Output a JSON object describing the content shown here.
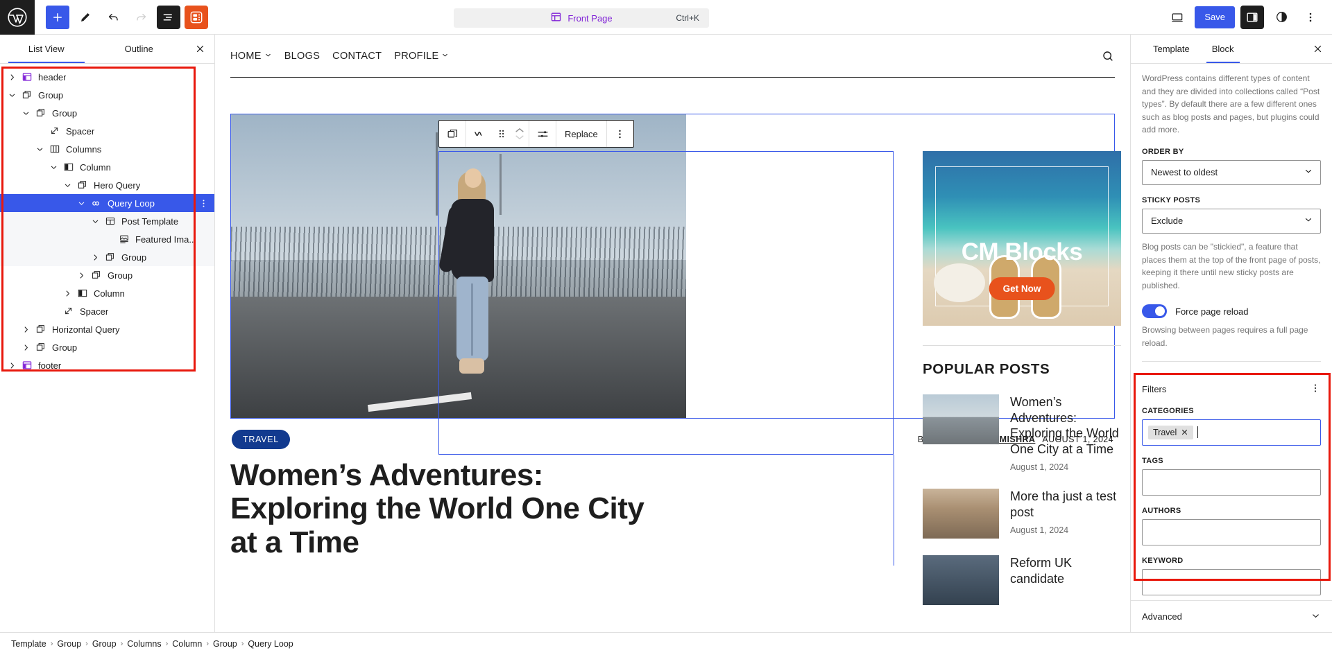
{
  "topbar": {
    "logo_icon": "wordpress-logo-icon",
    "add_block_label": "+",
    "tools": [
      {
        "name": "add-block-button",
        "icon": "plus-icon"
      },
      {
        "name": "edit-tool-button",
        "icon": "pencil-icon"
      },
      {
        "name": "undo-button",
        "icon": "undo-icon"
      },
      {
        "name": "redo-button",
        "icon": "redo-icon"
      },
      {
        "name": "list-view-button",
        "icon": "list-view-icon"
      },
      {
        "name": "plugin-blocks-button",
        "icon": "cm-blocks-icon"
      }
    ],
    "command_bar": {
      "icon": "template-icon",
      "label": "Front Page",
      "shortcut": "Ctrl+K"
    },
    "view_device_icon": "desktop-icon",
    "save_label": "Save",
    "sidebar_toggle_icon": "settings-sidebar-icon",
    "styles_icon": "contrast-styles-icon",
    "options_icon": "more-vertical-icon"
  },
  "list_view": {
    "tabs": [
      {
        "label": "List View",
        "active": true
      },
      {
        "label": "Outline",
        "active": false
      }
    ],
    "close_icon": "close-icon",
    "tree": [
      {
        "label": "header",
        "depth": 0,
        "icon": "template-part-icon",
        "chevron": "right",
        "state": "normal"
      },
      {
        "label": "Group",
        "depth": 0,
        "icon": "group-icon",
        "chevron": "down",
        "state": "normal"
      },
      {
        "label": "Group",
        "depth": 1,
        "icon": "group-icon",
        "chevron": "down",
        "state": "normal"
      },
      {
        "label": "Spacer",
        "depth": 2,
        "icon": "spacer-icon",
        "chevron": "none",
        "state": "normal"
      },
      {
        "label": "Columns",
        "depth": 2,
        "icon": "columns-icon",
        "chevron": "down",
        "state": "normal"
      },
      {
        "label": "Column",
        "depth": 3,
        "icon": "column-icon",
        "chevron": "down",
        "state": "normal"
      },
      {
        "label": "Hero Query",
        "depth": 4,
        "icon": "group-icon",
        "chevron": "down",
        "state": "normal"
      },
      {
        "label": "Query Loop",
        "depth": 5,
        "icon": "query-loop-icon",
        "chevron": "down",
        "state": "selected"
      },
      {
        "label": "Post Template",
        "depth": 6,
        "icon": "post-template-icon",
        "chevron": "down",
        "state": "shaded"
      },
      {
        "label": "Featured Ima...",
        "depth": 7,
        "icon": "featured-image-icon",
        "chevron": "none",
        "state": "shaded"
      },
      {
        "label": "Group",
        "depth": 6,
        "icon": "group-icon",
        "chevron": "right",
        "state": "shaded"
      },
      {
        "label": "Group",
        "depth": 5,
        "icon": "group-icon",
        "chevron": "right",
        "state": "normal"
      },
      {
        "label": "Column",
        "depth": 4,
        "icon": "column-icon",
        "chevron": "right",
        "state": "normal"
      },
      {
        "label": "Spacer",
        "depth": 3,
        "icon": "spacer-icon",
        "chevron": "none",
        "state": "normal"
      },
      {
        "label": "Horizontal Query",
        "depth": 1,
        "icon": "group-icon",
        "chevron": "right",
        "state": "normal"
      },
      {
        "label": "Group",
        "depth": 1,
        "icon": "group-icon",
        "chevron": "right",
        "state": "normal"
      },
      {
        "label": "footer",
        "depth": 0,
        "icon": "template-part-icon",
        "chevron": "right",
        "state": "normal"
      }
    ],
    "row_more_icon": "more-vertical-icon"
  },
  "block_toolbar": {
    "buttons": [
      {
        "name": "parent-block-button",
        "icon": "group-icon",
        "label": ""
      },
      {
        "name": "block-type-button",
        "icon": "query-loop-icon",
        "label": ""
      },
      {
        "name": "drag-handle",
        "icon": "drag-dots-icon",
        "label": ""
      },
      {
        "name": "move-up-down",
        "icon": "chevron-up-down-icon",
        "label": ""
      },
      {
        "name": "display-settings-button",
        "icon": "sliders-icon",
        "label": ""
      },
      {
        "name": "replace-button",
        "icon": "",
        "label": "Replace"
      },
      {
        "name": "block-options-button",
        "icon": "more-vertical-icon",
        "label": ""
      }
    ],
    "replace_label": "Replace"
  },
  "canvas": {
    "nav": [
      {
        "label": "HOME",
        "has_submenu": true
      },
      {
        "label": "BLOGS",
        "has_submenu": false
      },
      {
        "label": "CONTACT",
        "has_submenu": false
      },
      {
        "label": "PROFILE",
        "has_submenu": true
      }
    ],
    "search_icon": "search-icon",
    "hero": {
      "category": "TRAVEL",
      "by_label": "BY",
      "author": "ADMIN ANKIT MISHRA",
      "date": "AUGUST 1, 2024",
      "title": "Women’s Adventures: Exploring the World One City at a Time"
    },
    "promo": {
      "title": "CM Blocks",
      "button_label": "Get Now"
    },
    "popular": {
      "heading": "POPULAR POSTS",
      "posts": [
        {
          "title": "Women’s Adventures: Exploring the World One City at a Time",
          "date": "August 1, 2024",
          "thumb": "t1"
        },
        {
          "title": "More tha just a test post",
          "date": "August 1, 2024",
          "thumb": "t2"
        },
        {
          "title": "Reform UK candidate",
          "date": "",
          "thumb": "t3"
        }
      ]
    }
  },
  "inspector": {
    "tabs": [
      {
        "label": "Template",
        "active": false
      },
      {
        "label": "Block",
        "active": true
      }
    ],
    "close_icon": "close-icon",
    "post_type_help": "WordPress contains different types of content and they are divided into collections called “Post types”. By default there are a few different ones such as blog posts and pages, but plugins could add more.",
    "order_by": {
      "label": "ORDER BY",
      "value": "Newest to oldest"
    },
    "sticky_posts": {
      "label": "STICKY POSTS",
      "value": "Exclude"
    },
    "sticky_help": "Blog posts can be \"stickied\", a feature that places them at the top of the front page of posts, keeping it there until new sticky posts are published.",
    "force_reload": {
      "label": "Force page reload",
      "enabled": true,
      "help": "Browsing between pages requires a full page reload."
    },
    "filters": {
      "heading": "Filters",
      "more_icon": "more-vertical-icon",
      "categories": {
        "label": "CATEGORIES",
        "tokens": [
          "Travel"
        ],
        "remove_icon": "close-icon"
      },
      "tags": {
        "label": "TAGS",
        "value": ""
      },
      "authors": {
        "label": "AUTHORS",
        "value": ""
      },
      "keyword": {
        "label": "KEYWORD",
        "value": ""
      }
    },
    "advanced": {
      "label": "Advanced",
      "icon": "chevron-down-icon"
    }
  },
  "breadcrumb": {
    "items": [
      "Template",
      "Group",
      "Group",
      "Columns",
      "Column",
      "Group",
      "Query Loop"
    ],
    "separator": "›"
  },
  "colors": {
    "accent_blue": "#3858e9",
    "highlight_red": "#e8180c",
    "orange": "#e8521c",
    "purple": "#7f20d6",
    "dark": "#1e1e1e",
    "category_navy": "#123a8f"
  }
}
